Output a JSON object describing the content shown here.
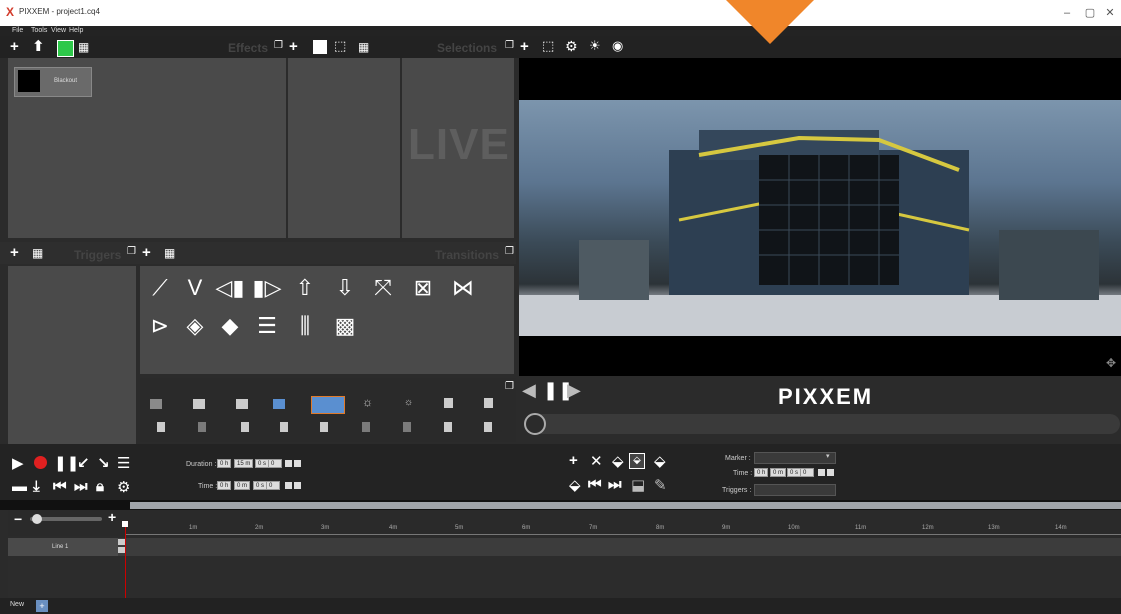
{
  "window": {
    "title": "PIXXEM - project1.cq4",
    "logo": "X",
    "minimize": "–",
    "maximize": "▢",
    "close": "✕"
  },
  "menu": [
    "File",
    "Tools",
    "View",
    "Help"
  ],
  "panels": {
    "effects_label": "Effects",
    "selections_label": "Selections",
    "triggers_label": "Triggers",
    "transitions_label": "Transitions",
    "live_label": "LIVE"
  },
  "effects": {
    "items": [
      {
        "label": "Blackout"
      }
    ]
  },
  "preview": {
    "brand": "PIXXEM"
  },
  "duration": {
    "label": "Duration :",
    "h": "0 h",
    "m": "15 m",
    "s": "0 s",
    "f": "0"
  },
  "time": {
    "label": "Time :",
    "h": "0 h",
    "m": "0 m",
    "s": "0 s",
    "f": "0"
  },
  "marker": {
    "label": "Marker :",
    "time_label": "Time :",
    "h": "0 h",
    "m": "0 m",
    "s": "0 s",
    "f": "0",
    "triggers_label": "Triggers :"
  },
  "timeline": {
    "ticks": [
      "1m",
      "2m",
      "3m",
      "4m",
      "5m",
      "6m",
      "7m",
      "8m",
      "9m",
      "10m",
      "11m",
      "12m",
      "13m",
      "14m"
    ],
    "line_label": "Line 1"
  },
  "footer": {
    "tab_label": "New",
    "add_label": "+"
  },
  "colors": {
    "accent": "#f0862a",
    "record": "#e02020",
    "green": "#2ec84a",
    "playhead": "#cc0000"
  }
}
